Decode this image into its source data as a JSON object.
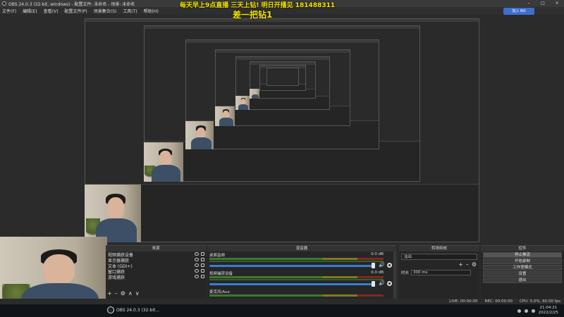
{
  "window": {
    "title": "OBS 24.0.3 (32-bit, windows) - 配置文件: 未命名 - 场景: 未命名",
    "controls": [
      "–",
      "□",
      "×"
    ]
  },
  "menu": {
    "items": [
      "文件(F)",
      "编辑(E)",
      "查看(V)",
      "配置文件(P)",
      "场景集合(S)",
      "工具(T)",
      "帮助(H)"
    ]
  },
  "top_button": {
    "label": "加入 Bili"
  },
  "overlay": {
    "line1": "每天早上9点直播 三天上钻! 明日开播见 181488311",
    "line2": "差一把钻1"
  },
  "docks": {
    "scenes_title": "",
    "sources_title": "来源",
    "mixer_title": "混音器",
    "transitions_title": "转场特效",
    "controls_title": "控件"
  },
  "sources": {
    "items": [
      "视频捕获设备",
      "显示器捕获",
      "文本 (GDI+)",
      "窗口捕获",
      "游戏捕获"
    ],
    "toolbar": [
      "+",
      "–",
      "⚙",
      "∧",
      "∨"
    ]
  },
  "mixer": {
    "tracks": [
      {
        "name": "桌面音频",
        "db": "0.0 dB"
      },
      {
        "name": "视频捕获设备",
        "db": "0.0 dB"
      },
      {
        "name": "麦克风/Aux",
        "db": ""
      }
    ]
  },
  "transitions": {
    "selected": "淡出",
    "duration_label": "时长",
    "duration_value": "300 ms",
    "tools": [
      "+",
      "–",
      "⚙"
    ]
  },
  "controls": {
    "buttons": [
      "停止推流",
      "开始录制",
      "工作室模式",
      "设置",
      "退出"
    ]
  },
  "status": {
    "live": "LIVE: 00:00:00",
    "rec": "REC: 00:00:00",
    "cpu": "CPU: 5.0%, 60.00 fps"
  },
  "taskbar": {
    "app_label": "OBS 24.0.3 (32-bit...",
    "time": "21:04:21",
    "date": "2022/2/25"
  }
}
